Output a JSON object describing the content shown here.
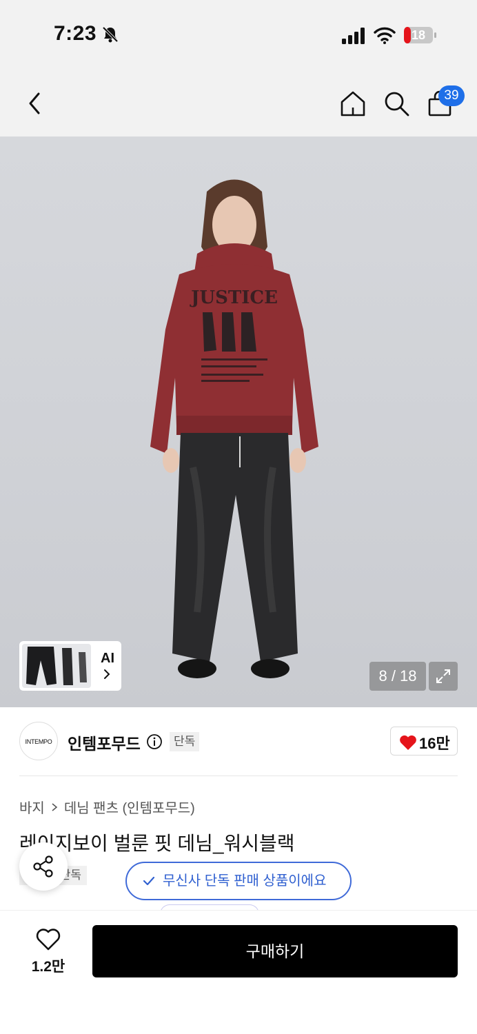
{
  "status_bar": {
    "time": "7:23",
    "battery": "18",
    "icons": [
      "bell-slash-icon",
      "signal-icon",
      "wifi-icon",
      "battery-icon"
    ]
  },
  "nav": {
    "icons": [
      "back-icon",
      "home-icon",
      "search-icon",
      "cart-icon"
    ],
    "cart_badge": "39"
  },
  "hero": {
    "thumb_label": "AI",
    "counter": "8 / 18",
    "colors": {
      "hoodie": "#8f2f33",
      "jeans": "#2a2a2c",
      "background": "#d3d5d9"
    }
  },
  "brand": {
    "logo_text": "INTEMPO",
    "name": "인템포무드",
    "tag": "단독",
    "like_count": "16만"
  },
  "breadcrumb": {
    "category": "바지",
    "subcategory": "데님 팬츠 (인템포무드)"
  },
  "product": {
    "title": "레이지보이 벌룬 핏 데님_워시블랙",
    "tag": "단독"
  },
  "exclusive_notice": "무신사 단독 판매 상품이에요",
  "bottom": {
    "wish_count": "1.2만",
    "buy_label": "구매하기"
  },
  "colors": {
    "accent": "#1f6fe8",
    "pill_border": "#3f6ad8",
    "heart": "#e5141b",
    "buy_bg": "#000000"
  }
}
